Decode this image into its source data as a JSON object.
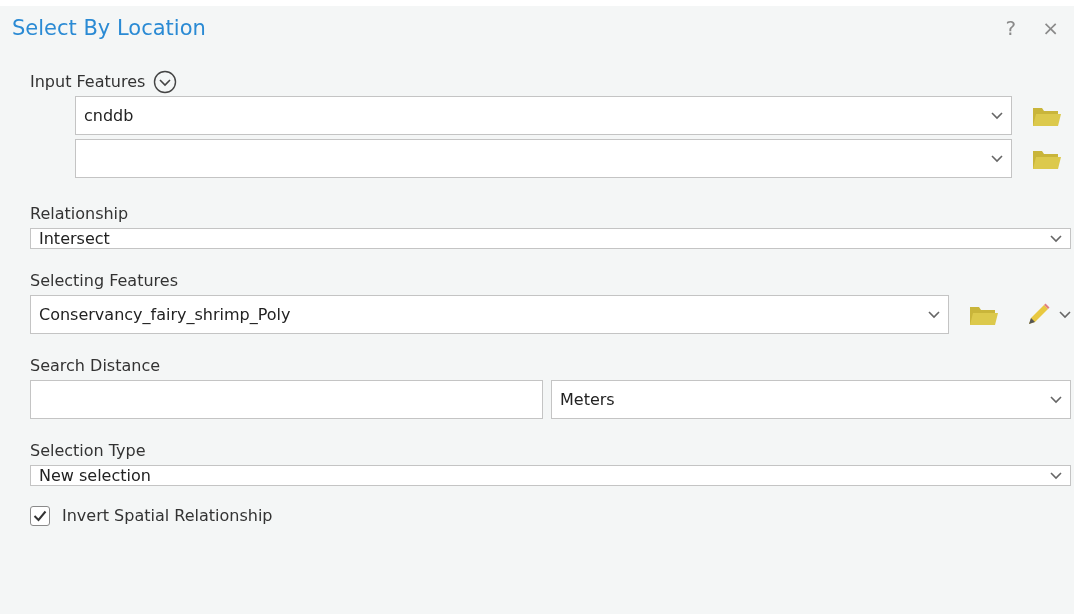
{
  "dialog": {
    "title": "Select By Location",
    "help": "?",
    "close": "×"
  },
  "input_features": {
    "label": "Input Features",
    "rows": [
      {
        "kind": "dropdown",
        "value": "cnddb"
      },
      {
        "kind": "dropdown"
      }
    ]
  },
  "relationship": {
    "label": "Relationship",
    "value": "Intersect"
  },
  "selecting_features": {
    "label": "Selecting Features",
    "value": "Conservancy_fairy_shrimp_Poly"
  },
  "search_distance": {
    "label": "Search Distance",
    "unit": "Meters"
  },
  "selection_type": {
    "label": "Selection Type",
    "value": "New selection"
  },
  "invert": {
    "label": "Invert Spatial Relationship",
    "checked": true
  }
}
